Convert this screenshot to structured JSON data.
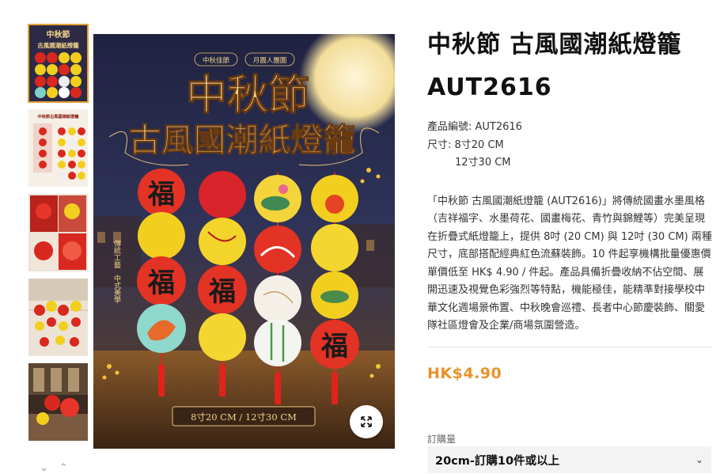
{
  "product": {
    "title": "中秋節 古風國潮紙燈籠 AUT2616",
    "code_line": "產品編號: AUT2616",
    "size_line1": "尺寸: 8寸20 CM",
    "size_line2": "12寸30 CM",
    "description": "「中秋節 古風國潮紙燈籠 (AUT2616)」將傳統國畫水墨風格（吉祥福字、水墨荷花、國畫梅花、青竹與錦鯉等）完美呈現在折疊式紙燈籠上，提供 8吋 (20 CM) 與 12吋 (30 CM) 兩種尺寸，底部搭配經典紅色流蘇裝飾。10 件起享機構批量優惠價單價低至 HK$ 4.90 / 件起。產品具備折疊收納不佔空間、展開迅速及視覺色彩強烈等特點，機能極佳，能精準對接學校中華文化週場景佈置、中秋晚會巡禮、長者中心節慶裝飾、關愛隊社區燈會及企業/商場氛圍營造。",
    "price": "HK$4.90",
    "qty_label": "訂購量",
    "qty_selected": "20cm-訂購10件或以上"
  },
  "image": {
    "tag_left": "中秋佳節",
    "tag_right": "月圓人團圓",
    "headline1": "中秋節",
    "headline2": "古風國潮紙燈籠",
    "side_text1": "傳統工藝",
    "side_text2": "中式美學",
    "bottom_caption": "8寸20 CM / 12寸30 CM",
    "fu": "福"
  },
  "thumbs": {
    "t1_title1": "中秋節",
    "t1_title2": "古風國潮紙燈籠",
    "t2_title": "中秋節古風國潮紙燈籠"
  },
  "icons": {
    "zoom": "expand-arrows-icon",
    "down": "chevron-down-icon",
    "up": "chevron-up-icon",
    "select": "chevron-down-icon"
  },
  "colors": {
    "price": "#e8922a",
    "active_thumb": "#e5a33a",
    "lantern_red": "#d9281f",
    "lantern_yellow": "#f2cf1f",
    "gold": "#f3d48a"
  }
}
